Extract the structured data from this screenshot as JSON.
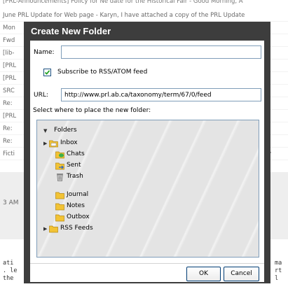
{
  "background": {
    "top_line": "[PRL-Announcements] Policy for Ne date for the Historical Fair - Good Morning, A",
    "rows": [
      {
        "left": "June PRL Update for Web page - Karyn, I have attached a copy of the PRL Update",
        "right": ""
      },
      {
        "left": "Mon",
        "right": "ne"
      },
      {
        "left": "Fwd",
        "right": "eck"
      },
      {
        "left": "[lib-",
        "right": "e su"
      },
      {
        "left": "[PRL",
        "right": "e th"
      },
      {
        "left": "[PRL",
        "right": "tern"
      },
      {
        "left": "SRC",
        "right": "ptio"
      },
      {
        "left": "Re:",
        "right": "eed"
      },
      {
        "left": "[PRL",
        "right": "vot"
      },
      {
        "left": "Re:",
        "right": "e Ma"
      },
      {
        "left": "Re:",
        "right": "ppar"
      },
      {
        "left": "Ficti",
        "right": "o my"
      }
    ],
    "time_fragment": "3 AM",
    "mono_left": [
      "ati",
      ". le",
      "the"
    ],
    "mono_right": [
      "ma",
      "rt",
      "l"
    ]
  },
  "dialog": {
    "title": "Create New Folder",
    "name_label": "Name:",
    "name_value": "",
    "subscribe_label": "Subscribe to RSS/ATOM feed",
    "subscribe_checked": true,
    "url_label": "URL:",
    "url_value": "http://www.prl.ab.ca/taxonomy/term/67/0/feed",
    "select_label": "Select where to place the new folder:",
    "tree": {
      "root": "Folders",
      "items": [
        {
          "label": "Inbox",
          "icon": "inbox-folder-icon",
          "expandable": true
        },
        {
          "label": "Chats",
          "icon": "chats-folder-icon",
          "expandable": false
        },
        {
          "label": "Sent",
          "icon": "sent-folder-icon",
          "expandable": false
        },
        {
          "label": "Trash",
          "icon": "trash-icon",
          "expandable": false
        },
        {
          "label": "Journal",
          "icon": "folder-icon",
          "expandable": false
        },
        {
          "label": "Notes",
          "icon": "folder-icon",
          "expandable": false
        },
        {
          "label": "Outbox",
          "icon": "folder-icon",
          "expandable": false
        },
        {
          "label": "RSS Feeds",
          "icon": "folder-icon",
          "expandable": true,
          "selected": true
        }
      ]
    },
    "ok_label": "OK",
    "cancel_label": "Cancel"
  },
  "colors": {
    "dialog_frame": "#3d3d3d",
    "folder_yellow": "#f2c335",
    "border_blue": "#7f9db9"
  }
}
